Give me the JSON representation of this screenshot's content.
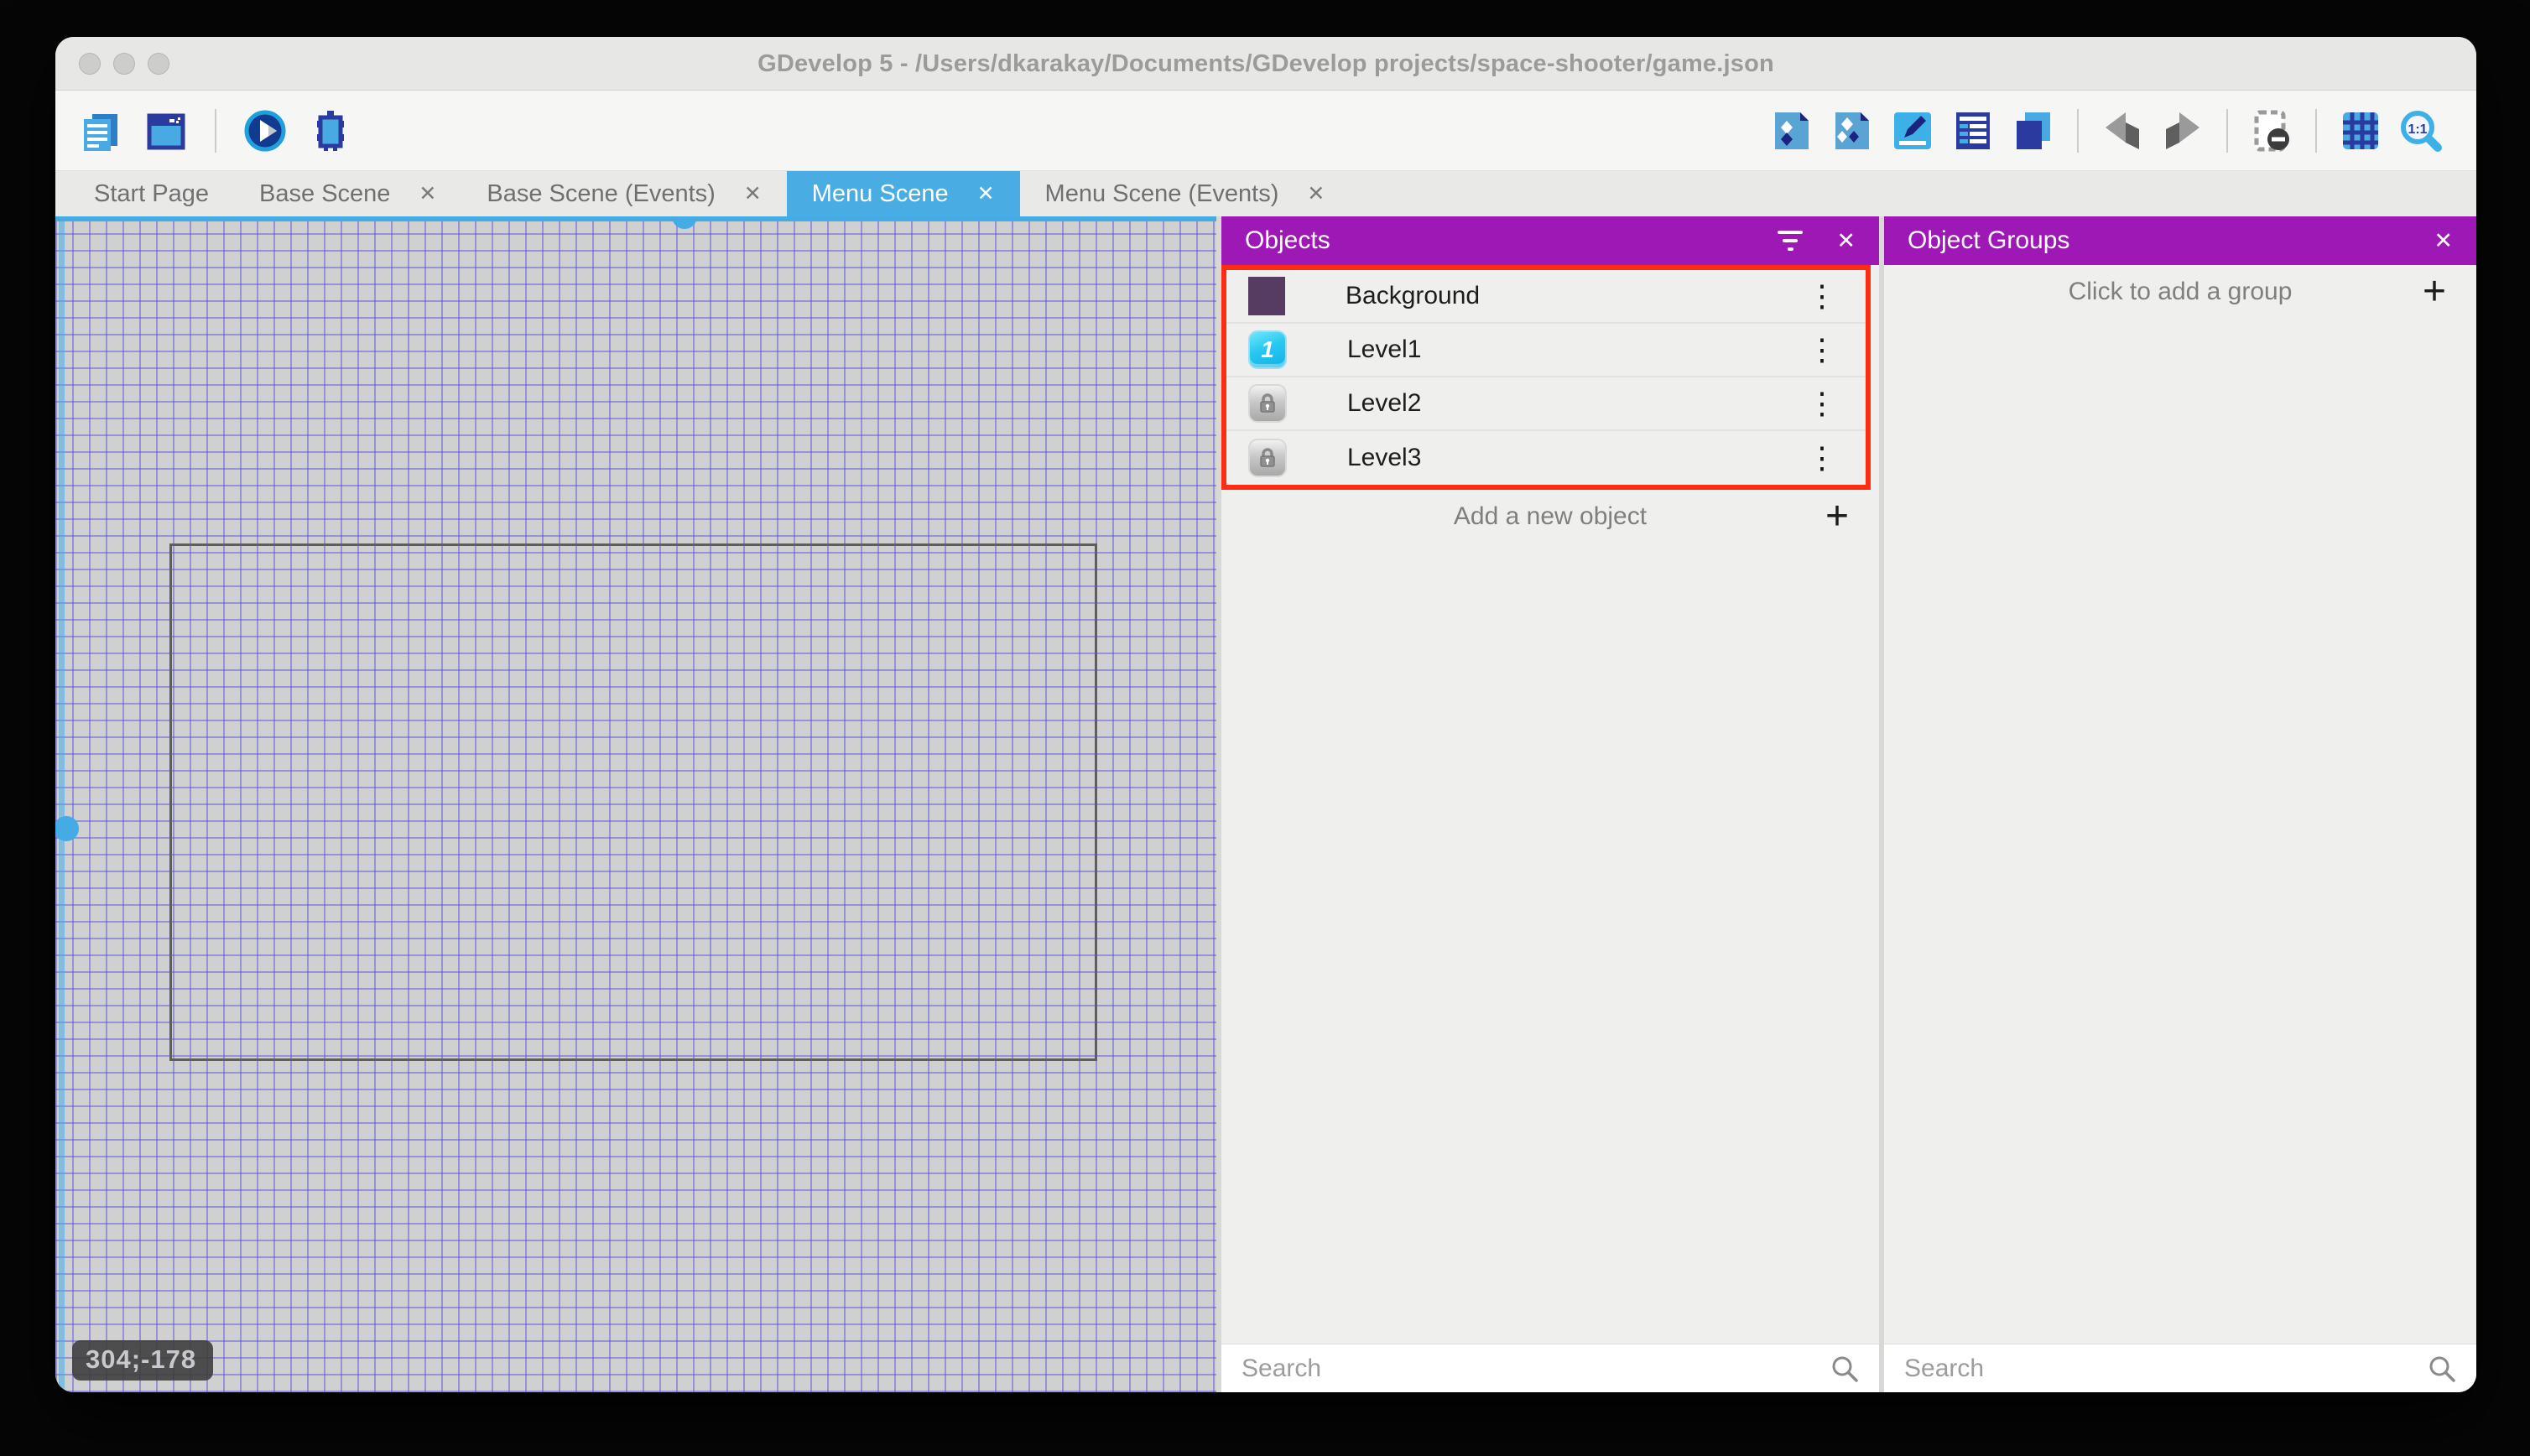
{
  "window": {
    "title": "GDevelop 5 - /Users/dkarakay/Documents/GDevelop projects/space-shooter/game.json"
  },
  "glyphs": {
    "close": "✕",
    "kebab": "⋮",
    "plus": "+",
    "level1_badge": "1",
    "zoom_ratio": "1:1"
  },
  "tabs": [
    {
      "label": "Start Page",
      "closable": false,
      "active": false
    },
    {
      "label": "Base Scene",
      "closable": true,
      "active": false
    },
    {
      "label": "Base Scene (Events)",
      "closable": true,
      "active": false
    },
    {
      "label": "Menu Scene",
      "closable": true,
      "active": true
    },
    {
      "label": "Menu Scene (Events)",
      "closable": true,
      "active": false
    }
  ],
  "canvas": {
    "coordinates": "304;-178"
  },
  "objects_panel": {
    "title": "Objects",
    "items": [
      {
        "name": "Background",
        "icon": "purple-square"
      },
      {
        "name": "Level1",
        "icon": "level1-button"
      },
      {
        "name": "Level2",
        "icon": "locked-button"
      },
      {
        "name": "Level3",
        "icon": "locked-button"
      }
    ],
    "add_label": "Add a new object",
    "search_placeholder": "Search"
  },
  "object_groups_panel": {
    "title": "Object Groups",
    "add_label": "Click to add a group",
    "search_placeholder": "Search"
  },
  "colors": {
    "accent_purple": "#9d18b5",
    "active_tab_blue": "#49ade3",
    "selection_blue": "#45abe4",
    "highlight_red": "#fd2c12",
    "grid_line": "#7b78e0",
    "canvas_bg": "#d0d0d0",
    "toolbar_navy": "#2a3a9e",
    "toolbar_light_blue": "#49a9e2"
  }
}
